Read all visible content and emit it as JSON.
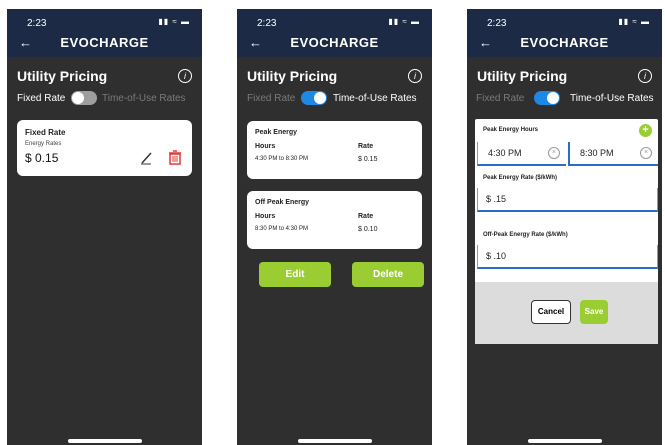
{
  "status": {
    "time": "2:23",
    "icons": "▮▮ ≈ ▬"
  },
  "header": {
    "back": "←",
    "brand": "EVOCHARGE"
  },
  "page": {
    "title": "Utility Pricing",
    "info": "i"
  },
  "toggle": {
    "fixed_label": "Fixed Rate",
    "tou_label": "Time-of-Use Rates",
    "colors": {
      "on": "#1e88e5",
      "off": "#9e9e9e"
    }
  },
  "screen1": {
    "card_title": "Fixed Rate",
    "energy_label": "Energy Rates",
    "rate_value": "$ 0.15",
    "edit_icon": "pencil-icon",
    "delete_icon": "trash-icon"
  },
  "screen2": {
    "peak": {
      "title": "Peak Energy",
      "hours_label": "Hours",
      "rate_label": "Rate",
      "hours": "4:30 PM to 8:30 PM",
      "rate": "$ 0.15"
    },
    "offpeak": {
      "title": "Off Peak Energy",
      "hours_label": "Hours",
      "rate_label": "Rate",
      "hours": "8:30 PM to 4:30 PM",
      "rate": "$ 0.10"
    },
    "edit_btn": "Edit",
    "delete_btn": "Delete"
  },
  "screen3": {
    "hours_title": "Peak Energy Hours",
    "start_time": "4:30 PM",
    "end_time": "8:30 PM",
    "peak_rate_label": "Peak Energy Rate ($/kWh)",
    "peak_rate_value": "$ .15",
    "offpeak_rate_label": "Off-Peak Energy Rate ($/kWh)",
    "offpeak_rate_value": "$ .10",
    "cancel_btn": "Cancel",
    "save_btn": "Save"
  },
  "colors": {
    "accent": "#9acd32",
    "navy": "#1d2a45",
    "danger": "#e53935"
  }
}
